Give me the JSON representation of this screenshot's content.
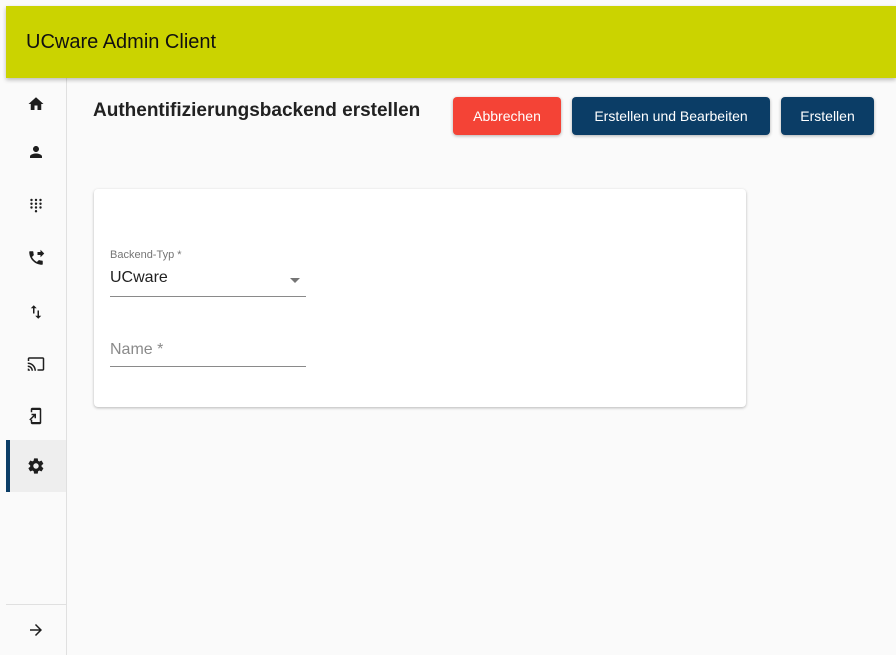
{
  "app": {
    "title": "UCware Admin Client"
  },
  "sidebar": {
    "items": [
      {
        "icon": "home-icon"
      },
      {
        "icon": "person-icon"
      },
      {
        "icon": "dialpad-icon"
      },
      {
        "icon": "phone-forward-icon"
      },
      {
        "icon": "swap-vert-icon"
      },
      {
        "icon": "cast-icon"
      },
      {
        "icon": "phonelink-setup-icon"
      },
      {
        "icon": "settings-icon",
        "active": true
      }
    ],
    "collapse_icon": "arrow-right-icon"
  },
  "page": {
    "title": "Authentifizierungsbackend erstellen"
  },
  "actions": {
    "cancel_label": "Abbrechen",
    "create_edit_label": "Erstellen und Bearbeiten",
    "create_label": "Erstellen"
  },
  "form": {
    "backend_type": {
      "label": "Backend-Typ *",
      "value": "UCware"
    },
    "name": {
      "placeholder": "Name *",
      "value": ""
    }
  },
  "colors": {
    "topbar": "#cbd300",
    "primary": "#0b3d66",
    "danger": "#f44336"
  }
}
